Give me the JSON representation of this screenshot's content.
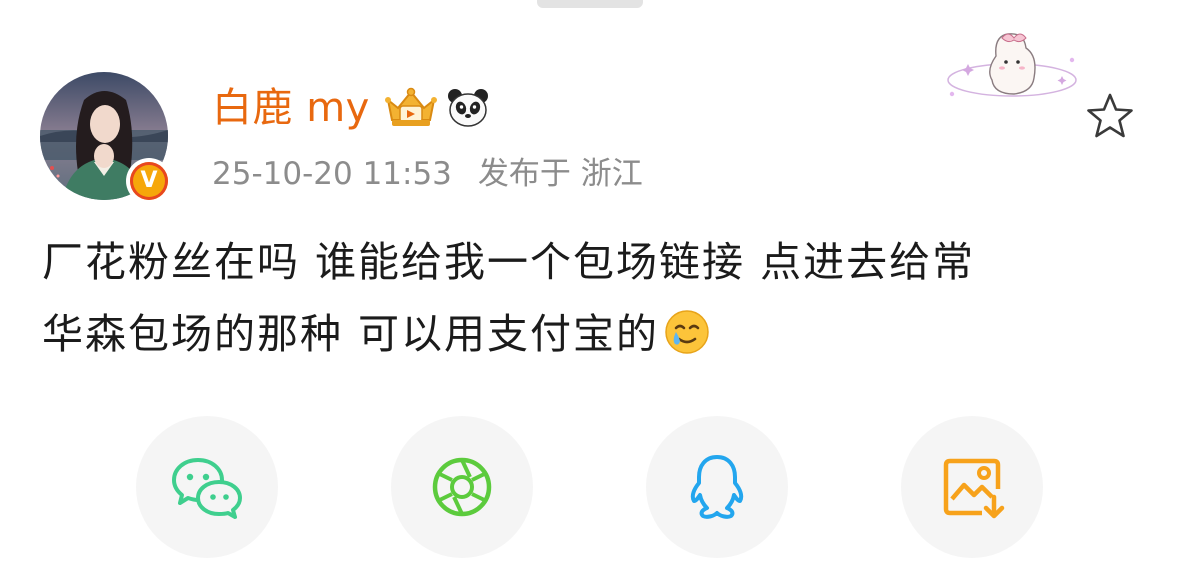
{
  "post": {
    "author": {
      "name": "白鹿 my",
      "verified_badge": "V",
      "avatar_icon": "avatar-photo",
      "badges": [
        "crown-badge-icon",
        "panda-icon"
      ]
    },
    "meta": {
      "timestamp": "25-10-20 11:53",
      "location": "发布于 浙江"
    },
    "content_lines": [
      "厂花粉丝在吗 谁能给我一个包场链接 点进去给常",
      "华森包场的那种 可以用支付宝的"
    ],
    "content_emoji": "smiling-face-with-tear-icon",
    "favorite_icon": "star-outline-icon"
  },
  "share": [
    {
      "icon": "wechat-icon",
      "color": "#3fcf8e"
    },
    {
      "icon": "moments-icon",
      "color": "#5ccb3d"
    },
    {
      "icon": "qq-icon",
      "color": "#23a6ee"
    },
    {
      "icon": "save-image-icon",
      "color": "#f7a21b"
    }
  ],
  "colors": {
    "username": "#e8680f",
    "meta_text": "#8c8c8c",
    "body_text": "#1b1b1b",
    "share_bg": "#f5f5f5"
  }
}
